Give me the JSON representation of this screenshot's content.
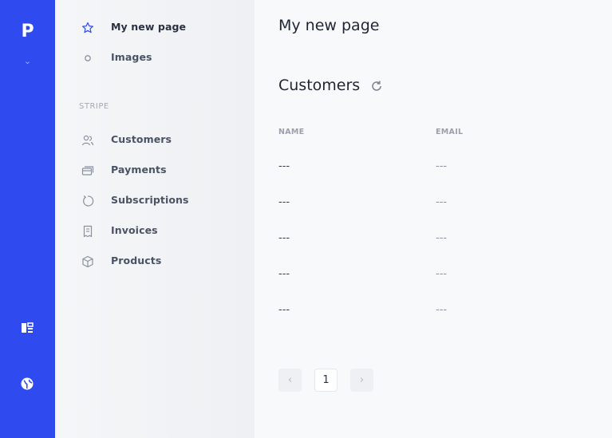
{
  "rail": {
    "logo": "P",
    "caret": "⌄",
    "icons": [
      "dashboard-icon",
      "globe-icon"
    ],
    "accent": "#2f4bf0"
  },
  "sidebar": {
    "items": [
      {
        "label": "My new page",
        "icon": "star-icon",
        "active": true
      },
      {
        "label": "Images",
        "icon": "circle-icon"
      }
    ],
    "section_label": "STRIPE",
    "stripe_items": [
      {
        "label": "Customers",
        "icon": "users-icon"
      },
      {
        "label": "Payments",
        "icon": "cards-icon"
      },
      {
        "label": "Subscriptions",
        "icon": "refresh-icon"
      },
      {
        "label": "Invoices",
        "icon": "invoice-icon"
      },
      {
        "label": "Products",
        "icon": "box-icon"
      }
    ]
  },
  "main": {
    "page_title": "My new page",
    "section_title": "Customers",
    "columns": [
      "NAME",
      "EMAIL"
    ],
    "rows": [
      [
        "---",
        "---"
      ],
      [
        "---",
        "---"
      ],
      [
        "---",
        "---"
      ],
      [
        "---",
        "---"
      ],
      [
        "---",
        "---"
      ]
    ],
    "pager": {
      "prev": "‹",
      "current": "1",
      "next": "›"
    }
  }
}
